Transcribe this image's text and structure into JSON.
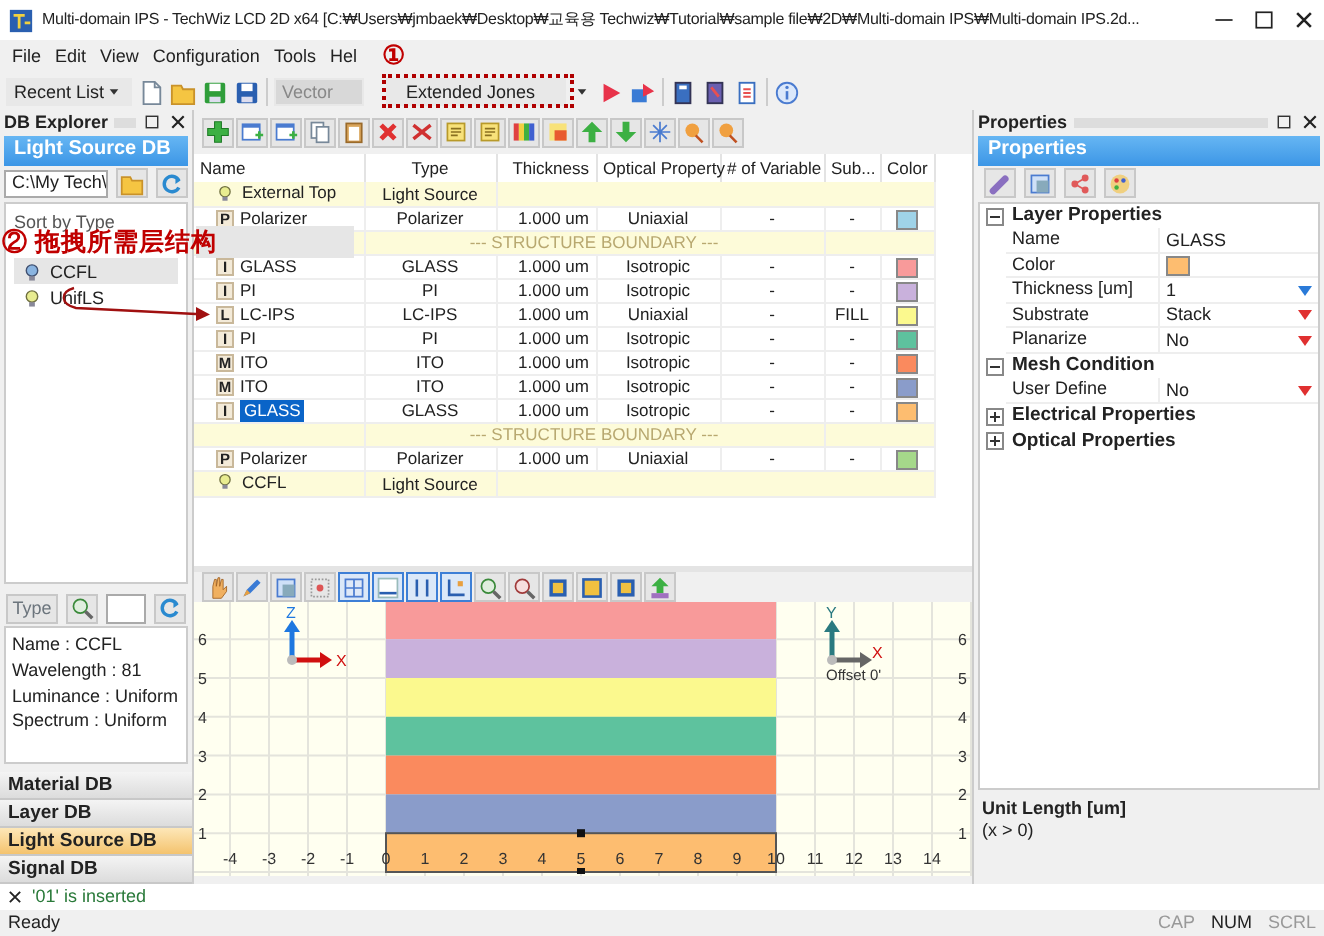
{
  "window": {
    "title": "Multi-domain IPS - TechWiz LCD 2D x64 [C:₩Users₩jmbaek₩Desktop₩교육용 Techwiz₩Tutorial₩sample file₩2D₩Multi-domain IPS₩Multi-domain IPS.2d..."
  },
  "menu": [
    "File",
    "Edit",
    "View",
    "Configuration",
    "Tools",
    "Hel"
  ],
  "toolbar": {
    "recent": "Recent List",
    "mode": {
      "value": "Vector",
      "disabled": true
    },
    "method": "Extended Jones"
  },
  "annotations": [
    {
      "mark": "①"
    },
    {
      "mark": "②",
      "text": "拖拽所需层结构"
    }
  ],
  "db_explorer": {
    "title": "DB Explorer",
    "current_db": "Light Source DB",
    "path": "C:\\My Tech\\",
    "list_header": "Sort by Type",
    "items": [
      {
        "label": "CCFL",
        "selected": true
      },
      {
        "label": "UnifLS",
        "selected": false
      }
    ],
    "type_button": {
      "label": "Type",
      "disabled": true
    },
    "info": [
      "Name : CCFL",
      "Wavelength : 81",
      "Luminance : Uniform",
      "Spectrum : Uniform"
    ],
    "db_tabs": [
      {
        "label": "Material DB",
        "selected": false
      },
      {
        "label": "Layer DB",
        "selected": false
      },
      {
        "label": "Light Source DB",
        "selected": true
      },
      {
        "label": "Signal DB",
        "selected": false
      }
    ]
  },
  "table": {
    "columns": [
      "Name",
      "Type",
      "Thickness",
      "Optical Property",
      "# of Variable",
      "Sub...",
      "Color"
    ],
    "rows": [
      {
        "kind": "source",
        "name": "External Top",
        "type": "Light Source",
        "selected": false
      },
      {
        "kind": "layer",
        "badge": "P",
        "name": "Polarizer",
        "type": "Polarizer",
        "thickness": "1.000 um",
        "optical": "Uniaxial",
        "variables": "-",
        "sub": "-",
        "color": "#9fd3e8",
        "selected": false
      },
      {
        "kind": "boundary",
        "label": "--- STRUCTURE BOUNDARY ---"
      },
      {
        "kind": "layer",
        "badge": "I",
        "name": "GLASS",
        "type": "GLASS",
        "thickness": "1.000 um",
        "optical": "Isotropic",
        "variables": "-",
        "sub": "-",
        "color": "#f89a9a",
        "selected": false
      },
      {
        "kind": "layer",
        "badge": "I",
        "name": "PI",
        "type": "PI",
        "thickness": "1.000 um",
        "optical": "Isotropic",
        "variables": "-",
        "sub": "-",
        "color": "#c9b1dc",
        "selected": false
      },
      {
        "kind": "layer",
        "badge": "L",
        "name": "LC-IPS",
        "type": "LC-IPS",
        "thickness": "1.000 um",
        "optical": "Uniaxial",
        "variables": "-",
        "sub": "FILL",
        "color": "#fbf98e",
        "selected": false
      },
      {
        "kind": "layer",
        "badge": "I",
        "name": "PI",
        "type": "PI",
        "thickness": "1.000 um",
        "optical": "Isotropic",
        "variables": "-",
        "sub": "-",
        "color": "#5ec29e",
        "selected": false
      },
      {
        "kind": "layer",
        "badge": "M",
        "name": "ITO",
        "type": "ITO",
        "thickness": "1.000 um",
        "optical": "Isotropic",
        "variables": "-",
        "sub": "-",
        "color": "#fa8a5e",
        "selected": false
      },
      {
        "kind": "layer",
        "badge": "M",
        "name": "ITO",
        "type": "ITO",
        "thickness": "1.000 um",
        "optical": "Isotropic",
        "variables": "-",
        "sub": "-",
        "color": "#8a9cca",
        "selected": false
      },
      {
        "kind": "layer",
        "badge": "I",
        "name": "GLASS",
        "type": "GLASS",
        "thickness": "1.000 um",
        "optical": "Isotropic",
        "variables": "-",
        "sub": "-",
        "color": "#fdbd70",
        "selected": true
      },
      {
        "kind": "boundary",
        "label": "--- STRUCTURE BOUNDARY ---"
      },
      {
        "kind": "layer",
        "badge": "P",
        "name": "Polarizer",
        "type": "Polarizer",
        "thickness": "1.000 um",
        "optical": "Uniaxial",
        "variables": "-",
        "sub": "-",
        "color": "#a5d88a",
        "selected": false
      },
      {
        "kind": "source",
        "name": "CCFL",
        "type": "Light Source",
        "selected": false
      }
    ]
  },
  "view_toolbar": [
    {
      "pressed": false
    },
    {
      "pressed": false
    },
    {
      "pressed": false
    },
    {
      "pressed": false
    },
    {
      "pressed": true
    },
    {
      "pressed": true
    },
    {
      "pressed": true
    },
    {
      "pressed": true
    },
    {
      "pressed": false
    },
    {
      "pressed": false
    },
    {
      "pressed": false
    },
    {
      "pressed": false
    },
    {
      "pressed": false
    },
    {
      "pressed": false
    }
  ],
  "structure_view": {
    "x_ticks": [
      "-4",
      "-3",
      "-2",
      "-1",
      "0",
      "1",
      "2",
      "3",
      "4",
      "5",
      "6",
      "7",
      "8",
      "9",
      "10",
      "11",
      "12",
      "13",
      "14"
    ],
    "left_ticks": [
      "6",
      "5",
      "4",
      "3",
      "2",
      "1"
    ],
    "right_ticks": [
      "6",
      "5",
      "4",
      "3",
      "2",
      "1"
    ],
    "left_axes": {
      "up": "Z",
      "right": "X"
    },
    "right_axes": {
      "up": "Y",
      "right": "X",
      "offset": "Offset 0'"
    }
  },
  "properties": {
    "title": "Properties",
    "tab": "Properties",
    "sections": [
      {
        "title": "Layer Properties",
        "expanded": true,
        "rows": [
          {
            "kind": "text",
            "name": "Name",
            "value": "GLASS"
          },
          {
            "kind": "color",
            "name": "Color",
            "color": "#fdbd70"
          },
          {
            "kind": "number",
            "name": "Thickness [um]",
            "value": "1"
          },
          {
            "kind": "choice",
            "name": "Substrate",
            "value": "Stack"
          },
          {
            "kind": "choice",
            "name": "Planarize",
            "value": "No"
          }
        ]
      },
      {
        "title": "Mesh Condition",
        "expanded": true,
        "rows": [
          {
            "kind": "choice",
            "name": "User Define",
            "value": "No"
          }
        ]
      },
      {
        "title": "Electrical Properties",
        "expanded": false
      },
      {
        "title": "Optical Properties",
        "expanded": false
      }
    ],
    "help_title": "Unit Length [um]",
    "help_text": "(x > 0)"
  },
  "message": {
    "text": "'01' is inserted"
  },
  "status": {
    "text": "Ready",
    "indicators": [
      {
        "label": "CAP",
        "on": false
      },
      {
        "label": "NUM",
        "on": true
      },
      {
        "label": "SCRL",
        "on": false
      }
    ]
  }
}
